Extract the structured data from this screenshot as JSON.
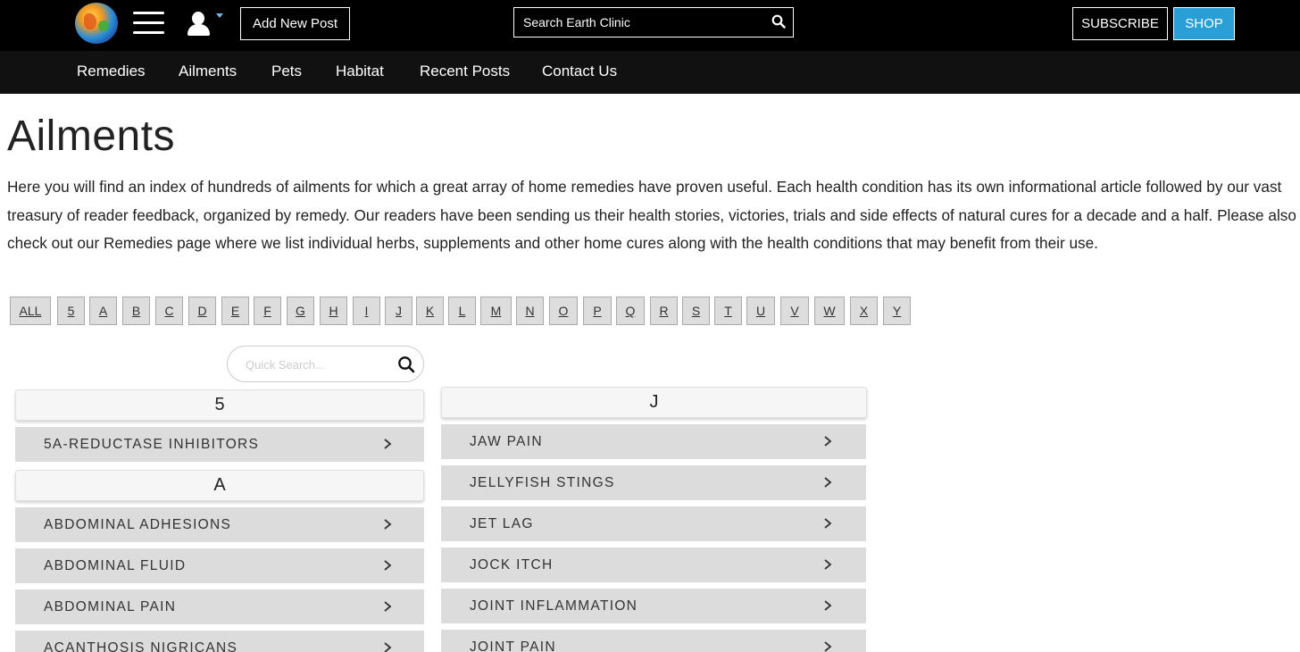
{
  "header": {
    "logo_icon": "earth-globe-logo",
    "menu_icon": "hamburger-menu-icon",
    "user_icon": "user-account-icon",
    "add_post_label": "Add New Post",
    "search_placeholder": "Search Earth Clinic",
    "subscribe_label": "SUBSCRIBE",
    "shop_label": "SHOP",
    "shop_color": "#2a9fd6"
  },
  "nav": {
    "items": [
      "Remedies",
      "Ailments",
      "Pets",
      "Habitat",
      "Recent Posts",
      "Contact Us"
    ]
  },
  "main": {
    "title": "Ailments",
    "intro": "Here you will find an index of hundreds of ailments for which a great array of home remedies have proven useful. Each health condition has its own informational article followed by our vast treasury of reader feedback, organized by remedy. Our readers have been sending us their health stories, victories, trials and side effects of natural cures for a decade and a half. Please also check out our Remedies page where we list individual herbs, supplements and other home cures along with the health conditions that may benefit from their use.",
    "letters": [
      "ALL",
      "5",
      "A",
      "B",
      "C",
      "D",
      "E",
      "F",
      "G",
      "H",
      "I",
      "J",
      "K",
      "L",
      "M",
      "N",
      "O",
      "P",
      "Q",
      "R",
      "S",
      "T",
      "U",
      "V",
      "W",
      "X",
      "Y"
    ],
    "quick_search_placeholder": "Quick Search...",
    "left_column": [
      {
        "heading": "5",
        "items": [
          "5A-REDUCTASE INHIBITORS"
        ]
      },
      {
        "heading": "A",
        "items": [
          "ABDOMINAL ADHESIONS",
          "ABDOMINAL FLUID",
          "ABDOMINAL PAIN",
          "ACANTHOSIS NIGRICANS"
        ]
      }
    ],
    "right_column": [
      {
        "heading": "J",
        "items": [
          "JAW PAIN",
          "JELLYFISH STINGS",
          "JET LAG",
          "JOCK ITCH",
          "JOINT INFLAMMATION",
          "JOINT PAIN"
        ]
      }
    ]
  }
}
